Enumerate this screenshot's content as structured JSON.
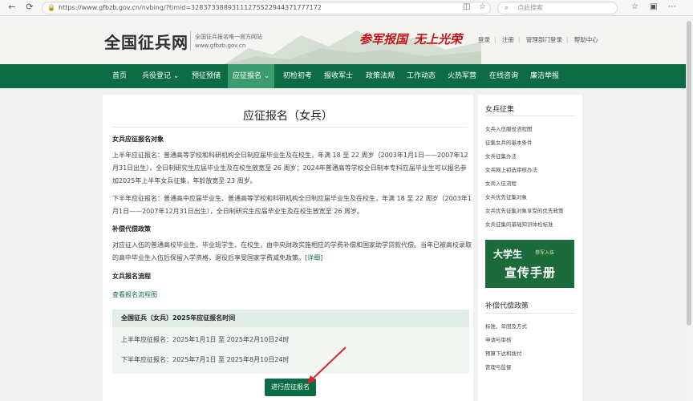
{
  "browser": {
    "url": "https://www.gfbzb.gov.cn/nvbing/?timid=32837338893111275522944371777172",
    "search_placeholder": "点此搜索"
  },
  "header": {
    "logo": "全国征兵网",
    "subtitle": "全国征兵报名唯一官方网站",
    "domain": "www.gfbzb.gov.cn",
    "slogan_left": "参军报国",
    "slogan_right": "无上光荣",
    "top_links": [
      "登录",
      "注册",
      "管理部门登录",
      "帮助中心"
    ]
  },
  "nav": {
    "items": [
      "首页",
      "兵役登记",
      "预征预储",
      "应征报名",
      "初检初考",
      "报收军士",
      "政策法规",
      "工作动态",
      "火热军营",
      "在线咨询",
      "廉洁举报"
    ],
    "dropdowns": [
      "兵役登记",
      "应征报名"
    ],
    "active": "应征报名"
  },
  "content": {
    "page_title": "应征报名（女兵）",
    "section1_heading": "女兵应征报名对象",
    "section1_p1": "上半年应征报名：普通高等学校和科研机构全日制应届毕业生及在校生，年满 18 至 22 周岁（2003年1月1日——2007年12月31日出生），全日制研究生应届毕业生及在校生放宽至 26 周岁；2024年普通高等学校全日制本专科应届毕业生可以报名参加2025年上半年女兵征集，年龄放宽至 23 周岁。",
    "section1_p2": "下半年应征报名：普通高中应届毕业生、普通高等学校和科研机构全日制应届毕业生及在校生，年满 18 至 22 周岁（2003年1月1日——2007年12月31日出生），全日制研究生应届毕业生及在校生放宽至 26 周岁。",
    "section2_heading": "补偿代偿政策",
    "section2_p": "对应征入伍的普通高校毕业生、毕业班学生、在校生，由中央财政实施相应的学费补偿和国家助学贷款代偿。当年已被高校录取的高中毕业生入伍后保留入学资格，退役后享受国家学费减免政策。",
    "section2_more": "[详细]",
    "section3_heading": "女兵报名流程",
    "flow_link": "查看报名流程图",
    "time_box_title": "全国征兵（女兵）2025年应征报名时间",
    "time_first": "上半年应征报名：2025年1月1日 至 2025年2月10日24时",
    "time_second": "下半年应征报名：2025年7月1日 至 2025年8月10日24时",
    "apply_button": "进行应征报名"
  },
  "sidebar": {
    "section1_title": "女兵征集",
    "section1_items": [
      "女兵入伍服役流程图",
      "征集女兵的基本条件",
      "女兵征集办法",
      "女兵网上初选审核办法",
      "女兵入伍流程",
      "女兵优先征集对象",
      "女兵优先征集对象享受的优先政策",
      "女兵征集的基础知识体检标准"
    ],
    "banner_big": "大学生",
    "banner_small": "参军入伍",
    "banner_sub": "宣传手册",
    "section2_title": "补偿代偿政策",
    "section2_items": [
      "标准、年限及方式",
      "申请与审核",
      "预算下达和拨付",
      "管理与监督"
    ]
  },
  "colors": {
    "brand_green": "#0d6b45",
    "nav_active": "#3c9b6f",
    "slogan_red": "#c0141b"
  },
  "icons": [
    "back-icon",
    "refresh-icon",
    "lock-icon",
    "reader-icon",
    "star-icon",
    "search-icon",
    "favorites-icon",
    "collections-icon",
    "menu-icon"
  ]
}
